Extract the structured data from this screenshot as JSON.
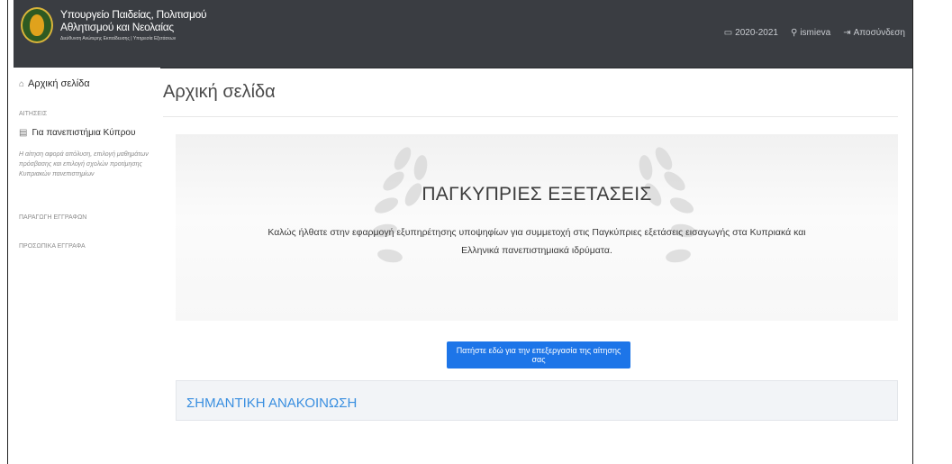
{
  "header": {
    "brand_line1": "Υπουργείο Παιδείας, Πολιτισμού",
    "brand_line2": "Αθλητισμού και Νεολαίας",
    "brand_line3": "Διεύθυνση Ανώτερης Εκπαίδευσης | Υπηρεσία Εξετάσεων",
    "year": "2020-2021",
    "username": "ismieva",
    "logout": "Αποσύνδεση"
  },
  "sidebar": {
    "home": "Αρχική σελίδα",
    "section_applications": "ΑΙΤΗΣΕΙΣ",
    "universities": "Για πανεπιστήμια Κύπρου",
    "universities_desc": "Η αίτηση αφορά απόλυση, επιλογή μαθημάτων πρόσβασης και επιλογή σχολών προτίμησης Κυπριακών πανεπιστημίων",
    "section_production": "ΠΑΡΑΓΩΓΗ ΕΓΓΡΑΦΩΝ",
    "section_personal": "ΠΡΟΣΩΠΙΚΑ ΕΓΓΡΑΦΑ"
  },
  "main": {
    "page_title": "Αρχική σελίδα",
    "hero_title": "ΠΑΓΚΥΠΡΙΕΣ ΕΞΕΤΑΣΕΙΣ",
    "hero_text_line1": "Καλώς ήλθατε στην εφαρμογή εξυπηρέτησης υποψηφίων για συμμετοχή στις Παγκύπριες εξετάσεις εισαγωγής στα Κυπριακά και",
    "hero_text_line2": "Ελληνικά πανεπιστημιακά ιδρύματα.",
    "apply_button": "Πατήστε εδώ για την επεξεργασία της αίτησης σας",
    "announcement_title": "ΣΗΜΑΝΤΙΚΗ ΑΝΑΚΟΙΝΩΣΗ"
  },
  "icons": {
    "calendar": "calendar-icon",
    "user": "user-icon",
    "logout": "logout-icon",
    "home": "home-icon",
    "document": "document-icon"
  },
  "colors": {
    "topbar": "#3a3d42",
    "primary_button": "#1d75e8",
    "announcement_title": "#3a8fe0"
  }
}
